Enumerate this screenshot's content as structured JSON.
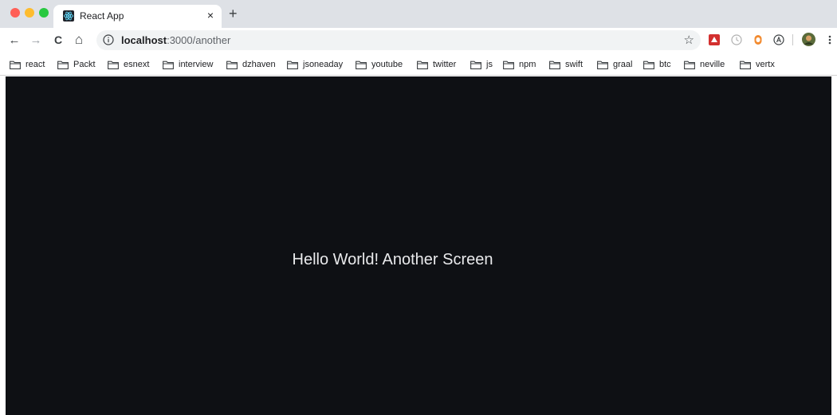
{
  "window": {
    "traffic_lights": {
      "close_color": "#ff5f57",
      "minimize_color": "#febc2e",
      "maximize_color": "#28c840"
    }
  },
  "tab": {
    "title": "React App",
    "favicon": "react-logo-icon",
    "close_glyph": "×"
  },
  "newtab_glyph": "+",
  "nav": {
    "back": "←",
    "forward": "→",
    "reload": "C",
    "home": "⌂"
  },
  "address": {
    "host": "localhost",
    "rest": ":3000/another"
  },
  "star_glyph": "☆",
  "bookmarks": [
    "react",
    "Packt",
    "esnext",
    "interview",
    "dzhaven",
    "jsoneaday",
    "youtube",
    "twitter",
    "js",
    "npm",
    "swift",
    "graal",
    "btc",
    "neville",
    "vertx"
  ],
  "content": {
    "background": "#0e1014",
    "message": "Hello World! Another Screen"
  }
}
